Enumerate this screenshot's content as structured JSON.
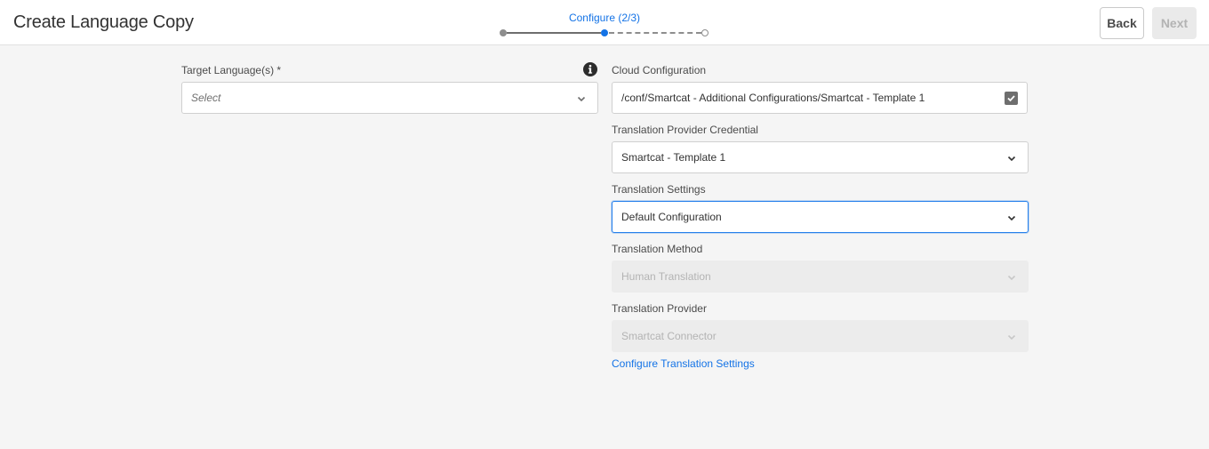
{
  "header": {
    "title": "Create Language Copy",
    "step_label": "Configure (2/3)",
    "back_label": "Back",
    "next_label": "Next"
  },
  "left": {
    "target_label": "Target Language(s) *",
    "target_placeholder": "Select"
  },
  "right": {
    "cloud_label": "Cloud Configuration",
    "cloud_value": "/conf/Smartcat - Additional Configurations/Smartcat - Template 1",
    "credential_label": "Translation Provider Credential",
    "credential_value": "Smartcat - Template 1",
    "settings_label": "Translation Settings",
    "settings_value": "Default Configuration",
    "method_label": "Translation Method",
    "method_value": "Human Translation",
    "provider_label": "Translation Provider",
    "provider_value": "Smartcat Connector",
    "configure_link": "Configure Translation Settings"
  },
  "colors": {
    "accent": "#1473e6",
    "focus": "#2680eb",
    "disabled_text": "#b3b3b3"
  },
  "icons": [
    "info-icon",
    "checkbox-checked-icon",
    "chevron-down-icon"
  ]
}
